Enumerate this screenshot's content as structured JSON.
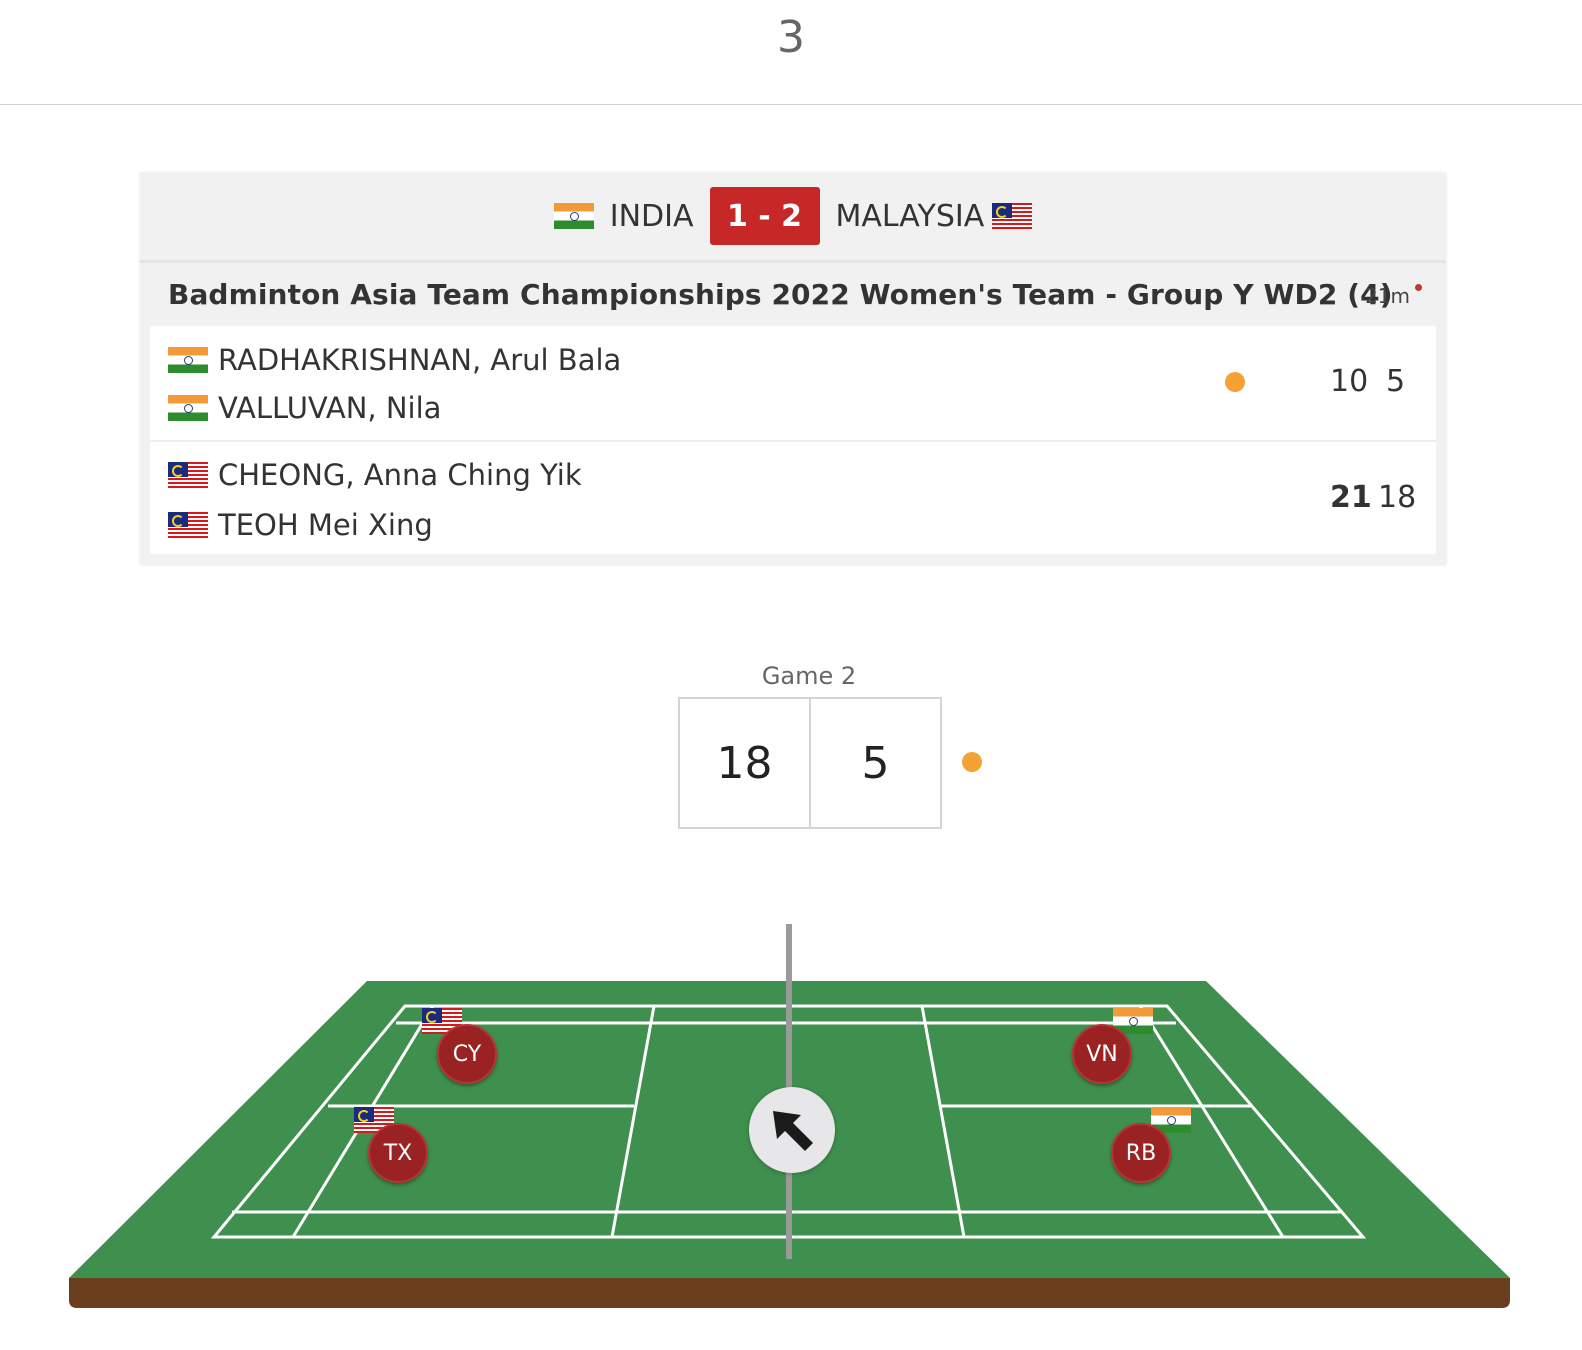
{
  "header": {
    "number": "3"
  },
  "tie": {
    "home_team": "INDIA",
    "away_team": "MALAYSIA",
    "score": "1 - 2",
    "home_flag": "india-flag",
    "away_flag": "malaysia-flag"
  },
  "match": {
    "title": "Badminton Asia Team Championships 2022 Women's Team - Group Y WD2 (4)",
    "duration": "21m",
    "teams": [
      {
        "players": [
          "RADHAKRISHNAN, Arul Bala",
          "VALLUVAN, Nila"
        ],
        "flag": "india-flag",
        "serving": true,
        "scores": [
          "10",
          "5"
        ]
      },
      {
        "players": [
          "CHEONG, Anna Ching Yik",
          "TEOH Mei Xing"
        ],
        "flag": "malaysia-flag",
        "serving": false,
        "scores": [
          "21",
          "18"
        ],
        "won_set": 1
      }
    ]
  },
  "current_game": {
    "label": "Game 2",
    "left_score": "18",
    "right_score": "5"
  },
  "court": {
    "players": [
      {
        "initials": "CY",
        "flag": "malaysia-flag"
      },
      {
        "initials": "TX",
        "flag": "malaysia-flag"
      },
      {
        "initials": "VN",
        "flag": "india-flag"
      },
      {
        "initials": "RB",
        "flag": "india-flag"
      }
    ],
    "shuttle_icon": "arrow-up-left-icon"
  },
  "colors": {
    "tie_score_bg": "#c62828",
    "serve_dot": "#f4a233",
    "court_green": "#3f8f4e",
    "player_badge": "#9a2222"
  }
}
